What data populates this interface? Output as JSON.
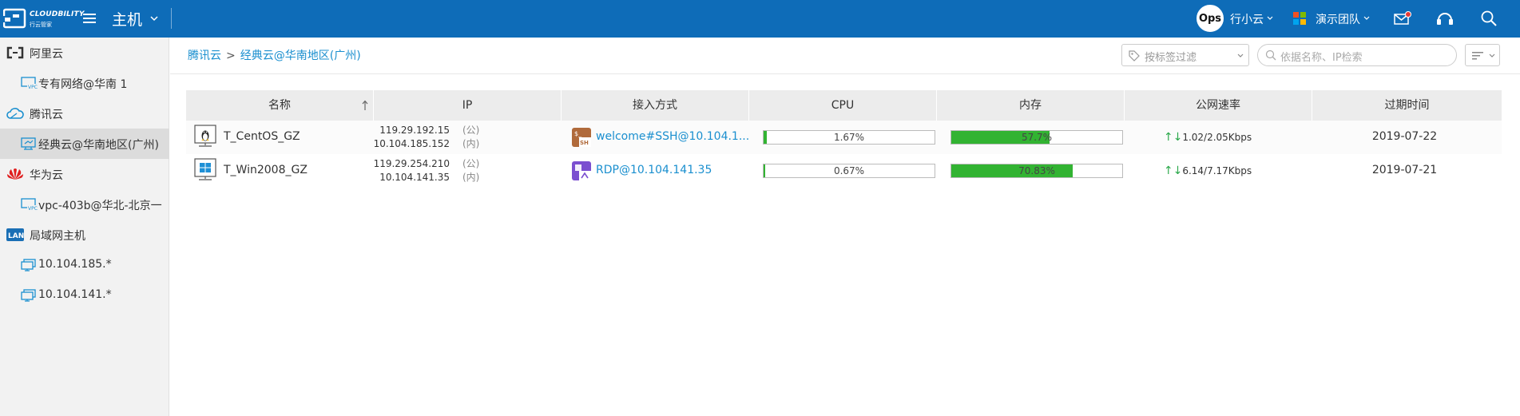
{
  "header": {
    "logo_brand": "CLOUDBILITY",
    "logo_sub": "行云管家",
    "nav_title": "主机",
    "avatar_text": "Ops",
    "user_name": "行小云",
    "team_name": "演示团队",
    "colors": {
      "bar": "#0e6cb8",
      "notify_dot": "#e53935"
    }
  },
  "sidebar": {
    "items": [
      {
        "label": "阿里云",
        "type": "group",
        "icon": "aliyun-icon"
      },
      {
        "label": "专有网络@华南 1",
        "type": "child",
        "icon": "vpc-icon"
      },
      {
        "label": "腾讯云",
        "type": "group",
        "icon": "tencent-cloud-icon"
      },
      {
        "label": "经典云@华南地区(广州)",
        "type": "child",
        "icon": "classic-cloud-icon",
        "active": true
      },
      {
        "label": "华为云",
        "type": "group",
        "icon": "huawei-icon"
      },
      {
        "label": "vpc-403b@华北-北京一",
        "type": "child",
        "icon": "vpc-icon"
      },
      {
        "label": "局域网主机",
        "type": "group",
        "icon": "lan-icon"
      },
      {
        "label": "10.104.185.*",
        "type": "child",
        "icon": "monitor-icon"
      },
      {
        "label": "10.104.141.*",
        "type": "child",
        "icon": "monitor-icon"
      }
    ]
  },
  "breadcrumb": {
    "provider": "腾讯云",
    "sep": ">",
    "region": "经典云@华南地区(广州)"
  },
  "toolbar": {
    "tag_filter_label": "按标签过滤",
    "search_placeholder": "依据名称、IP检索"
  },
  "table": {
    "columns": [
      "名称",
      "IP",
      "接入方式",
      "CPU",
      "内存",
      "公网速率",
      "过期时间"
    ],
    "rows": [
      {
        "name": "T_CentOS_GZ",
        "os_icon": "linux-icon",
        "ip_public": "119.29.192.15",
        "ip_public_tag": "(公)",
        "ip_private": "10.104.185.152",
        "ip_private_tag": "(内)",
        "access": "welcome#SSH@10.104.1...",
        "access_icon": "ssh-icon",
        "cpu": 1.67,
        "cpu_text": "1.67%",
        "mem": 57.7,
        "mem_text": "57.7%",
        "speed": "1.02/2.05Kbps",
        "expire": "2019-07-22"
      },
      {
        "name": "T_Win2008_GZ",
        "os_icon": "windows-icon",
        "ip_public": "119.29.254.210",
        "ip_public_tag": "(公)",
        "ip_private": "10.104.141.35",
        "ip_private_tag": "(内)",
        "access": "RDP@10.104.141.35",
        "access_icon": "rdp-icon",
        "cpu": 0.67,
        "cpu_text": "0.67%",
        "mem": 70.83,
        "mem_text": "70.83%",
        "speed": "6.14/7.17Kbps",
        "expire": "2019-07-21"
      }
    ],
    "speed_arrows": "↑↓",
    "colors": {
      "usage_bar": "#32b332",
      "link": "#1a8fcf"
    }
  }
}
